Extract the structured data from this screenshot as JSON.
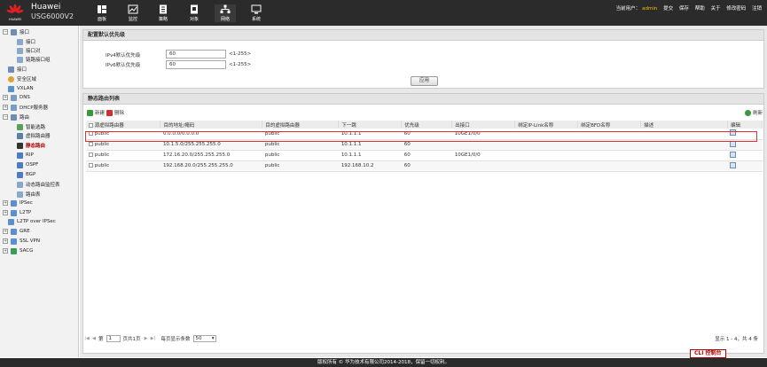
{
  "brand": {
    "name": "Huawei",
    "model": "USG6000V2",
    "logo_text": "HUAWEI"
  },
  "nav": [
    {
      "label": "面板",
      "icon": "dashboard-icon"
    },
    {
      "label": "监控",
      "icon": "monitor-icon"
    },
    {
      "label": "策略",
      "icon": "policy-icon"
    },
    {
      "label": "对象",
      "icon": "object-icon"
    },
    {
      "label": "网络",
      "icon": "network-icon"
    },
    {
      "label": "系统",
      "icon": "system-icon"
    }
  ],
  "user_area": {
    "current_user_label": "当前用户：",
    "username": "admin",
    "links": [
      "提交",
      "保存",
      "帮助",
      "关于",
      "修改密码",
      "注销"
    ]
  },
  "sidebar": {
    "items": [
      "接口",
      "接口",
      "接口对",
      "链路接口组",
      "接口",
      "安全区域",
      "VXLAN",
      "DNS",
      "DHCP服务器",
      "路由",
      "智能选路",
      "虚拟路由器",
      "静态路由",
      "RIP",
      "OSPF",
      "BGP",
      "动态路由监控表",
      "路由表",
      "IPSec",
      "L2TP",
      "L2TP over IPSec",
      "GRE",
      "SSL VPN",
      "SACG"
    ]
  },
  "priority_panel": {
    "title": "配置默认优先级",
    "ipv4_label": "IPv4默认优先级",
    "ipv4_value": "60",
    "ipv4_hint": "<1-255>",
    "ipv6_label": "IPv6默认优先级",
    "ipv6_value": "60",
    "ipv6_hint": "<1-255>",
    "apply_label": "应用"
  },
  "route_panel": {
    "title": "静态路由列表",
    "new_label": "新建",
    "delete_label": "删除",
    "refresh_label": "刷新",
    "columns": [
      "源虚拟路由器",
      "目的地址/掩码",
      "目的虚拟路由器",
      "下一跳",
      "优先级",
      "出接口",
      "绑定IP-Link名称",
      "绑定BFD名称",
      "描述",
      "编辑"
    ],
    "rows": [
      [
        "public",
        "0.0.0.0/0.0.0.0",
        "public",
        "10.1.1.1",
        "60",
        "10GE1/0/0",
        "",
        "",
        ""
      ],
      [
        "public",
        "10.1.5.0/255.255.255.0",
        "public",
        "10.1.1.1",
        "60",
        "",
        "",
        "",
        ""
      ],
      [
        "public",
        "172.16.20.0/255.255.255.0",
        "public",
        "10.1.1.1",
        "60",
        "10GE1/0/0",
        "",
        "",
        ""
      ],
      [
        "public",
        "192.168.20.0/255.255.255.0",
        "public",
        "192.168.10.2",
        "60",
        "",
        "",
        "",
        ""
      ]
    ]
  },
  "pager": {
    "page_label": "第",
    "page_value": "1",
    "page_total": "页共1页",
    "per_page_label": "每页显示条数",
    "per_page_value": "50",
    "info": "显示 1 - 4，共 4 条"
  },
  "cli_label": "CLI 控制台",
  "footer": "版权所有 © 华为技术有限公司2014-2018，保留一切权利。"
}
